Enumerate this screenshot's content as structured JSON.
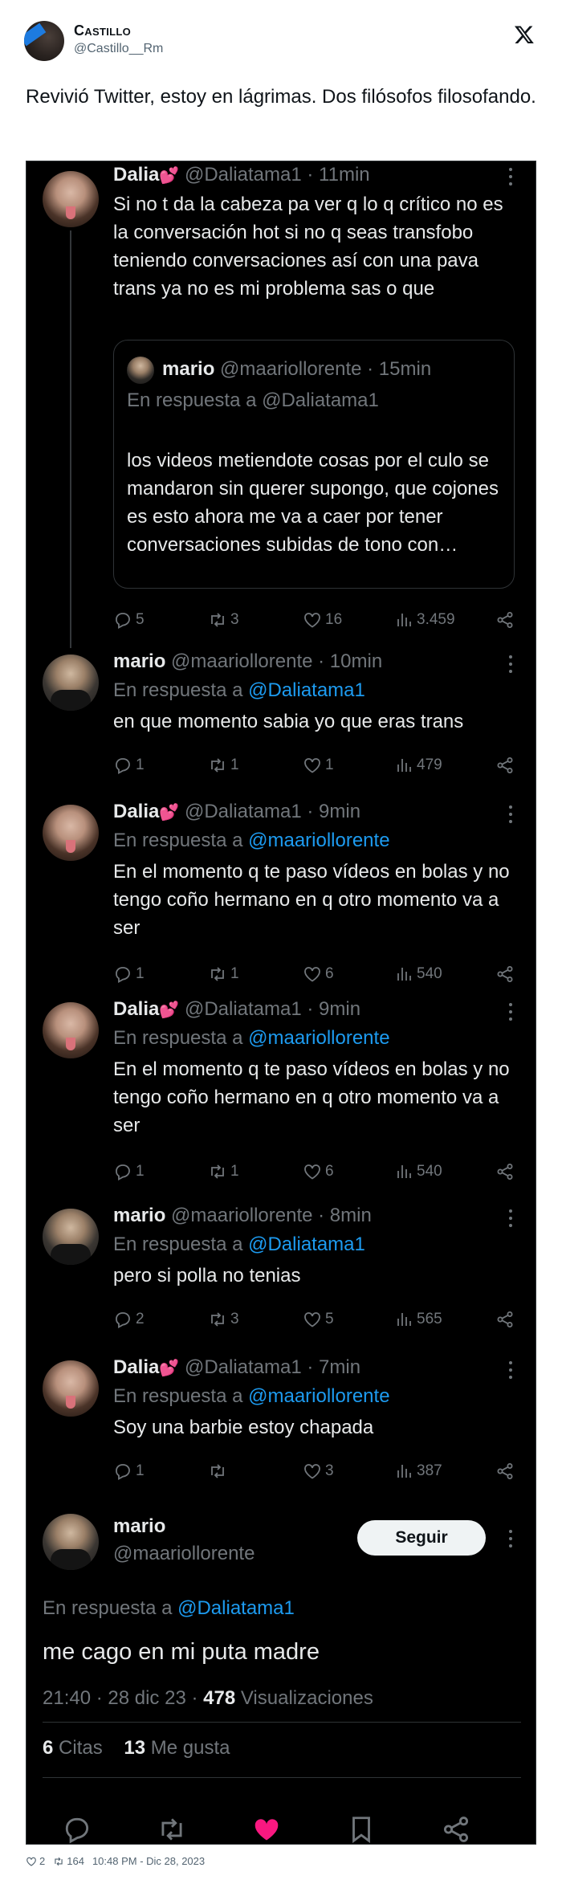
{
  "outer": {
    "name": "Castillo",
    "handle": "@Castillo__Rm",
    "text": "Revivió Twitter, estoy en lágrimas. Dos filósofos filosofando.",
    "footer": {
      "likes": "2",
      "retweets": "164",
      "time": "10:48 PM - Dic 28, 2023"
    }
  },
  "thread": {
    "tweets": [
      {
        "name": "Dalia",
        "name_emoji": "💕",
        "handle": "@Daliatama1",
        "time": "· 11min",
        "body": "Si no t da la cabeza pa ver q lo q crítico no es la conversación hot si no q seas transfobo teniendo conversaciones así con una pava trans ya no es mi problema sas o que",
        "quote": {
          "name": "mario",
          "handle": "@maariollorente",
          "time": "· 15min",
          "reply_prefix": "En respuesta a",
          "reply_to": "@Daliatama1",
          "body": "los videos metiendote cosas por el culo se mandaron sin querer supongo, que cojones es esto ahora me va a caer por tener conversaciones subidas de tono con…"
        },
        "replies": "5",
        "retweets": "3",
        "likes": "16",
        "views": "3.459"
      },
      {
        "name": "mario",
        "handle": "@maariollorente",
        "time": "· 10min",
        "reply_prefix": "En respuesta a",
        "reply_to": "@Daliatama1",
        "body": "en que momento sabia yo que eras trans",
        "replies": "1",
        "retweets": "1",
        "likes": "1",
        "views": "479"
      },
      {
        "name": "Dalia",
        "name_emoji": "💕",
        "handle": "@Daliatama1",
        "time": "· 9min",
        "reply_prefix": "En respuesta a",
        "reply_to": "@maariollorente",
        "body": "En el momento q te paso vídeos en bolas y no tengo coño hermano en q otro momento va a ser",
        "replies": "1",
        "retweets": "1",
        "likes": "6",
        "views": "540"
      },
      {
        "name": "Dalia",
        "name_emoji": "💕",
        "handle": "@Daliatama1",
        "time": "· 9min",
        "reply_prefix": "En respuesta a",
        "reply_to": "@maariollorente",
        "body": "En el momento q te paso vídeos en bolas y no tengo coño hermano en q otro momento va a ser",
        "replies": "1",
        "retweets": "1",
        "likes": "6",
        "views": "540"
      },
      {
        "name": "mario",
        "handle": "@maariollorente",
        "time": "· 8min",
        "reply_prefix": "En respuesta a",
        "reply_to": "@Daliatama1",
        "body": "pero si polla no tenias",
        "replies": "2",
        "retweets": "3",
        "likes": "5",
        "views": "565"
      },
      {
        "name": "Dalia",
        "name_emoji": "💕",
        "handle": "@Daliatama1",
        "time": "· 7min",
        "reply_prefix": "En respuesta a",
        "reply_to": "@maariollorente",
        "body": "Soy una barbie estoy chapada",
        "replies": "1",
        "retweets": "",
        "likes": "3",
        "views": "387"
      }
    ],
    "main": {
      "name": "mario",
      "handle": "@maariollorente",
      "follow_label": "Seguir",
      "reply_prefix": "En respuesta a",
      "reply_to": "@Daliatama1",
      "body": "me cago en mi puta madre",
      "timestamp": "21:40 · 28 dic 23 ·",
      "views_count": "478",
      "views_label": "Visualizaciones",
      "quotes_count": "6",
      "quotes_label": "Citas",
      "likes_count": "13",
      "likes_label": "Me gusta"
    }
  },
  "colors": {
    "background": "#000000",
    "text": "#e7e9ea",
    "muted": "#71767b",
    "link": "#1d9bf0",
    "like_active": "#f91880"
  }
}
